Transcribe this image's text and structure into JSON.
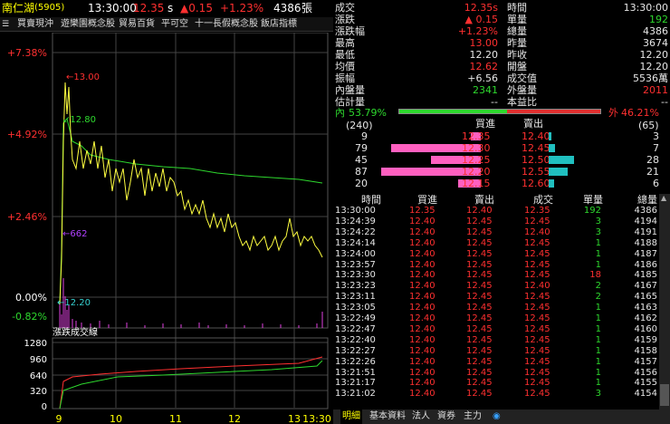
{
  "header": {
    "stock": "南仁湖",
    "code": "(5905)",
    "time": "13:30:00",
    "price": "12.35",
    "flag": "s",
    "change": "▲0.15",
    "pct": "+1.23%",
    "volume": "4386",
    "vol_unit": "張"
  },
  "toolbar": [
    "買賣現沖",
    "遊樂園概念股",
    "貿易百貨",
    "平可空",
    "十一長假概念股",
    "飯店指標"
  ],
  "chart": {
    "y_labels": [
      "+7.38%",
      "+4.92%",
      "+2.46%",
      "0.00%",
      "-0.82%"
    ],
    "annot": {
      "high": "13.00",
      "avg": "12.80",
      "vol": "662",
      "low": "12.20"
    },
    "sub_title": "漲跌成交線",
    "sub_y": [
      "1280",
      "960",
      "640",
      "320",
      "0"
    ],
    "x_labels": [
      "9",
      "10",
      "11",
      "12",
      "13",
      "13:30"
    ]
  },
  "quote": {
    "left": [
      [
        "成交",
        "12.35s"
      ],
      [
        "漲跌",
        "▲ 0.15"
      ],
      [
        "漲跌幅",
        "+1.23%"
      ],
      [
        "最高",
        "13.00"
      ],
      [
        "最低",
        "12.20"
      ],
      [
        "均價",
        "12.62"
      ],
      [
        "振幅",
        "+6.56"
      ],
      [
        "內盤量",
        "2341"
      ],
      [
        "估計量",
        "--"
      ]
    ],
    "right": [
      [
        "時間",
        "13:30:00"
      ],
      [
        "單量",
        "192"
      ],
      [
        "總量",
        "4386"
      ],
      [
        "昨量",
        "3674"
      ],
      [
        "昨收",
        "12.20"
      ],
      [
        "開盤",
        "12.20"
      ],
      [
        "成交值",
        "5536萬"
      ],
      [
        "外盤量",
        "2011"
      ],
      [
        "本益比",
        "--"
      ]
    ]
  },
  "ratio": {
    "in_label": "內",
    "in_pct": "53.79%",
    "out_label": "外",
    "out_pct": "46.21%"
  },
  "book": {
    "bid_total": "(240)",
    "bid_hdr": "買進",
    "ask_hdr": "賣出",
    "ask_total": "(65)",
    "rows": [
      {
        "bq": "9",
        "bp": "12.35",
        "ap": "12.40",
        "aq": "3",
        "bw": 0.1,
        "aw": 0.1
      },
      {
        "bq": "79",
        "bp": "12.30",
        "ap": "12.45",
        "aq": "7",
        "bw": 0.9,
        "aw": 0.25
      },
      {
        "bq": "45",
        "bp": "12.25",
        "ap": "12.50",
        "aq": "28",
        "bw": 0.5,
        "aw": 1.0
      },
      {
        "bq": "87",
        "bp": "12.20",
        "ap": "12.55",
        "aq": "21",
        "bw": 1.0,
        "aw": 0.75
      },
      {
        "bq": "20",
        "bp": "12.15",
        "ap": "12.60",
        "aq": "6",
        "bw": 0.23,
        "aw": 0.2
      }
    ]
  },
  "ticks": {
    "headers": [
      "時間",
      "買進",
      "賣出",
      "成交",
      "單量",
      "總量"
    ],
    "rows": [
      [
        "13:30:00",
        "12.35",
        "12.40",
        "12.35",
        "192",
        "4386"
      ],
      [
        "13:24:39",
        "12.40",
        "12.45",
        "12.45",
        "3",
        "4194"
      ],
      [
        "13:24:22",
        "12.40",
        "12.45",
        "12.40",
        "3",
        "4191"
      ],
      [
        "13:24:14",
        "12.40",
        "12.45",
        "12.45",
        "1",
        "4188"
      ],
      [
        "13:24:00",
        "12.40",
        "12.45",
        "12.45",
        "1",
        "4187"
      ],
      [
        "13:23:57",
        "12.40",
        "12.45",
        "12.45",
        "1",
        "4186"
      ],
      [
        "13:23:30",
        "12.40",
        "12.45",
        "12.45",
        "18",
        "4185"
      ],
      [
        "13:23:23",
        "12.40",
        "12.45",
        "12.40",
        "2",
        "4167"
      ],
      [
        "13:23:11",
        "12.40",
        "12.45",
        "12.45",
        "2",
        "4165"
      ],
      [
        "13:23:05",
        "12.40",
        "12.45",
        "12.45",
        "1",
        "4163"
      ],
      [
        "13:22:49",
        "12.40",
        "12.45",
        "12.45",
        "1",
        "4162"
      ],
      [
        "13:22:47",
        "12.40",
        "12.45",
        "12.45",
        "1",
        "4160"
      ],
      [
        "13:22:40",
        "12.40",
        "12.45",
        "12.45",
        "1",
        "4159"
      ],
      [
        "13:22:27",
        "12.40",
        "12.45",
        "12.45",
        "1",
        "4158"
      ],
      [
        "13:22:26",
        "12.40",
        "12.45",
        "12.45",
        "1",
        "4157"
      ],
      [
        "13:21:51",
        "12.40",
        "12.45",
        "12.45",
        "1",
        "4156"
      ],
      [
        "13:21:17",
        "12.40",
        "12.45",
        "12.45",
        "1",
        "4155"
      ],
      [
        "13:21:02",
        "12.40",
        "12.45",
        "12.45",
        "3",
        "4154"
      ]
    ]
  },
  "tabs": [
    "明細",
    "基本資料",
    "法人",
    "資券",
    "主力"
  ]
}
